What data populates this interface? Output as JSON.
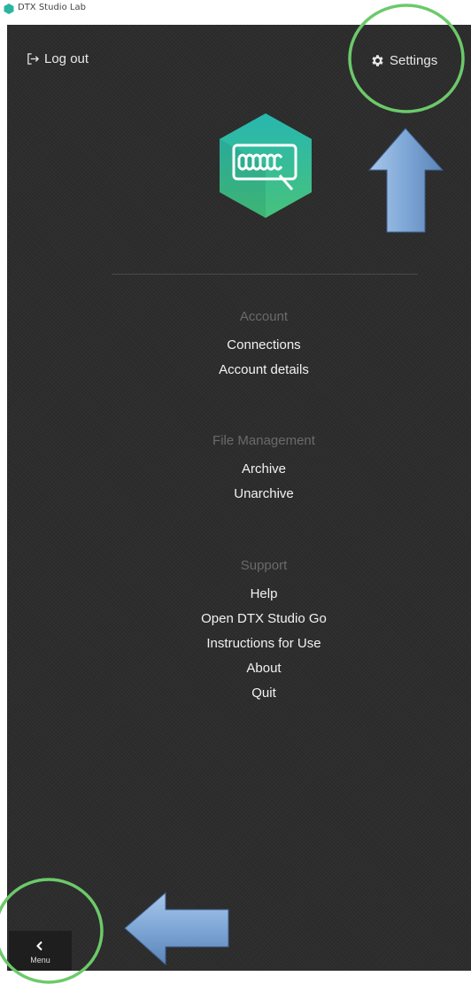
{
  "app": {
    "title": "DTX Studio Lab"
  },
  "header": {
    "logout_label": "Log out",
    "settings_label": "Settings"
  },
  "sections": [
    {
      "header": "Account",
      "items": [
        "Connections",
        "Account details"
      ]
    },
    {
      "header": "File Management",
      "items": [
        "Archive",
        "Unarchive"
      ]
    },
    {
      "header": "Support",
      "items": [
        "Help",
        "Open DTX Studio Go",
        "Instructions for Use",
        "About",
        "Quit"
      ]
    }
  ],
  "footer": {
    "menu_label": "Menu"
  },
  "colors": {
    "panel_bg": "#2d2d2d",
    "logo_teal": "#2bb5a0",
    "logo_green": "#3cc28a",
    "annotation_circle": "#6cc96a",
    "annotation_arrow": "#8fb4dc"
  },
  "icons": {
    "logout": "logout-icon",
    "settings": "gear-icon",
    "logo": "dental-app-logo-icon",
    "menu": "chevron-left-icon"
  }
}
